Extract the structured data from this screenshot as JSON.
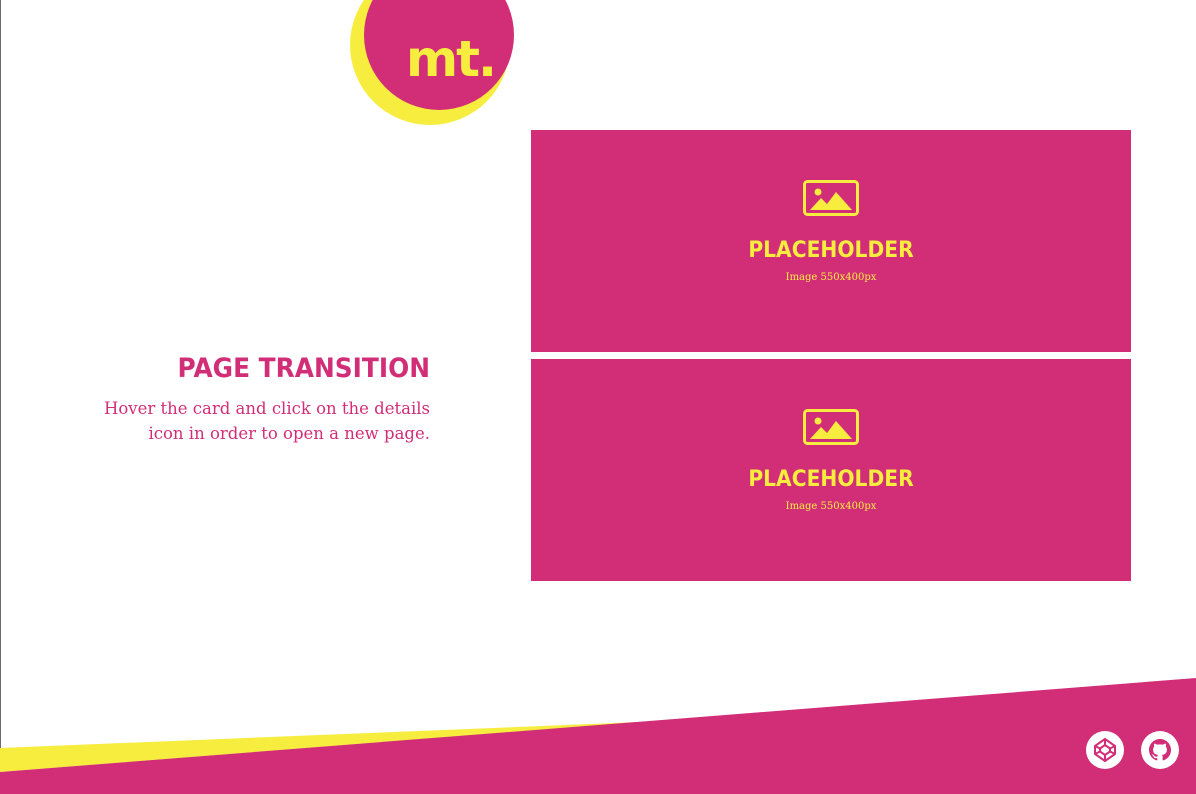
{
  "colors": {
    "primary": "#d22e78",
    "accent": "#f7ed3f",
    "background": "#ffffff"
  },
  "logo": {
    "text": "mt."
  },
  "intro": {
    "title": "PAGE TRANSITION",
    "line1": "Hover the card and click on the details",
    "line2": "icon in order to open a new page."
  },
  "cards": [
    {
      "icon": "image-icon",
      "title": "PLACEHOLDER",
      "subtitle": "Image 550x400px"
    },
    {
      "icon": "image-icon",
      "title": "PLACEHOLDER",
      "subtitle": "Image 550x400px"
    }
  ],
  "footer": {
    "links": [
      {
        "icon": "codepen-icon"
      },
      {
        "icon": "github-icon"
      }
    ]
  }
}
